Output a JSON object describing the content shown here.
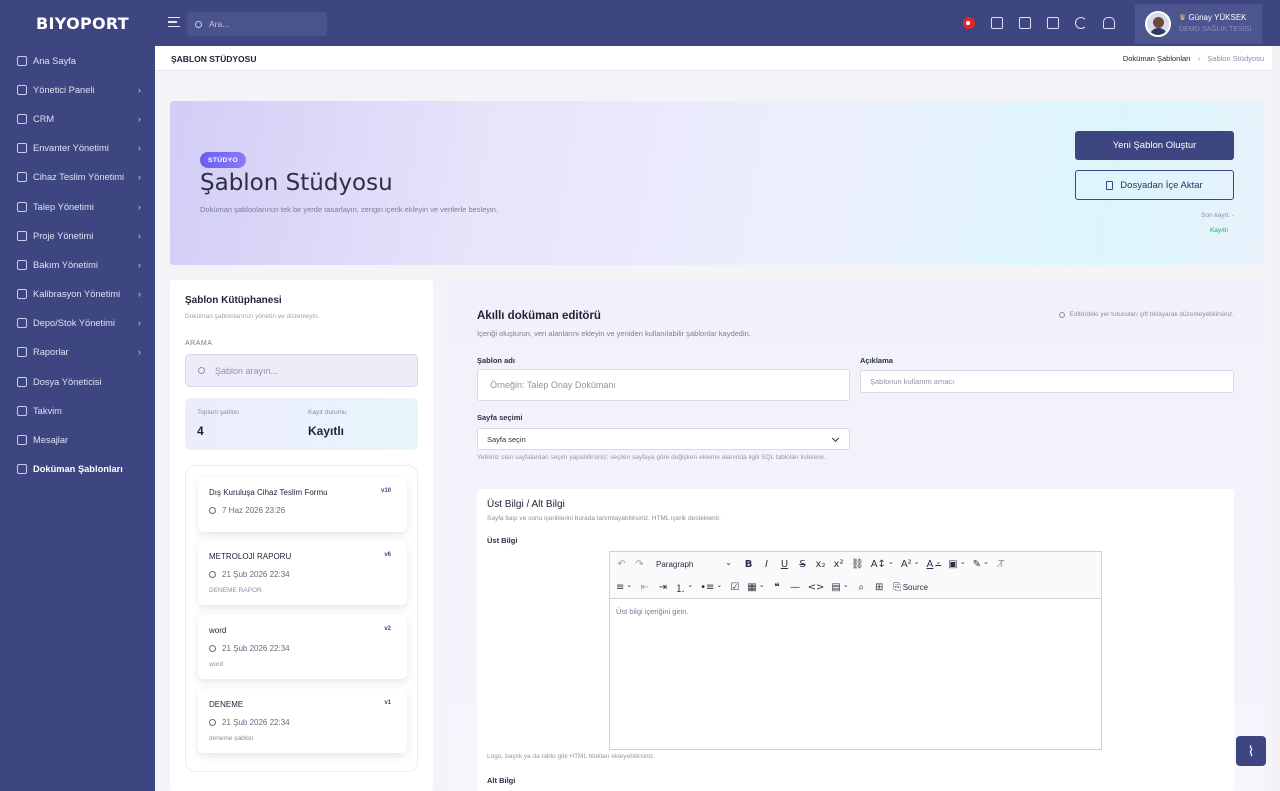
{
  "brand": "BIYOPORT",
  "sidebar": {
    "items": [
      {
        "label": "Ana Sayfa",
        "chev": ""
      },
      {
        "label": "Yönetici Paneli",
        "chev": "›"
      },
      {
        "label": "CRM",
        "chev": "›"
      },
      {
        "label": "Envanter Yönetimi",
        "chev": "›"
      },
      {
        "label": "Cihaz Teslim Yönetimi",
        "chev": "›"
      },
      {
        "label": "Talep Yönetimi",
        "chev": "›"
      },
      {
        "label": "Proje Yönetimi",
        "chev": "›"
      },
      {
        "label": "Bakım Yönetimi",
        "chev": "›"
      },
      {
        "label": "Kalibrasyon Yönetimi",
        "chev": "›"
      },
      {
        "label": "Depo/Stok Yönetimi",
        "chev": "›"
      },
      {
        "label": "Raporlar",
        "chev": "›"
      },
      {
        "label": "Dosya Yöneticisi",
        "chev": ""
      },
      {
        "label": "Takvim",
        "chev": ""
      },
      {
        "label": "Mesajlar",
        "chev": ""
      },
      {
        "label": "Doküman Şablonları",
        "chev": ""
      }
    ]
  },
  "topbar": {
    "search_placeholder": "Ara...",
    "user_name": "Günay YÜKSEK",
    "user_crown": "♛",
    "user_org": "DEMO SAĞLIK TESİSİ"
  },
  "breadcrumb": {
    "page_title": "ŞABLON STÜDYOSU",
    "parent": "Doküman Şablonları",
    "separator": "›",
    "current": "Şablon Stüdyosu"
  },
  "hero": {
    "badge": "STÜDYO",
    "title": "Şablon Stüdyosu",
    "description": "Doküman şablonlarınızı tek bir yerde tasarlayın, zengin içerik ekleyin ve verilerle besleyin.",
    "new_button": "Yeni Şablon Oluştur",
    "import_button": "Dosyadan İçe Aktar",
    "last_save_label": "Son kayıt: -",
    "save_status": "Kayıtlı"
  },
  "library": {
    "title": "Şablon Kütüphanesi",
    "subtitle": "Doküman şablonlarınızı yönetin ve düzenleyin.",
    "search_label": "ARAMA",
    "search_placeholder": "Şablon arayın...",
    "total_label": "Toplam şablon",
    "total_value": "4",
    "status_label": "Kayıt durumu",
    "status_value": "Kayıtlı",
    "templates": [
      {
        "name": "Dış Kuruluşa Cihaz Teslim Formu",
        "version": "v10",
        "date": "7 Haz 2026 23:26",
        "desc": ""
      },
      {
        "name": "METROLOJİ RAPORU",
        "version": "v6",
        "date": "21 Şub 2026 22:34",
        "desc": "DENEME RAPOR"
      },
      {
        "name": "word",
        "version": "v2",
        "date": "21 Şub 2026 22:34",
        "desc": "word"
      },
      {
        "name": "DENEME",
        "version": "v1",
        "date": "21 Şub 2026 22:34",
        "desc": "deneme şablon"
      }
    ]
  },
  "editor": {
    "title": "Akıllı doküman editörü",
    "subtitle": "İçeriği oluşturun, veri alanlarını ekleyin ve yeniden kullanılabilir şablonlar kaydedin.",
    "hint": "Editördeki yer tutucuları çift tıklayarak düzenleyebilirsiniz.",
    "name_label": "Şablon adı",
    "name_placeholder": "Örneğin: Talep Onay Dokümanı",
    "desc_label": "Açıklama",
    "desc_placeholder": "Şablonun kullanım amacı",
    "page_label": "Sayfa seçimi",
    "page_value": "Sayfa seçin",
    "page_help": "Yetkiniz olan sayfalardan seçim yapabilirsiniz; seçilen sayfaya göre değişken ekleme alanında ilgili SQL tabloları listelenir."
  },
  "header_footer": {
    "title": "Üst Bilgi / Alt Bilgi",
    "subtitle": "Sayfa başı ve sonu içeriklerini burada tanımlayabilirsiniz. HTML içerik desteklenir.",
    "header_label": "Üst Bilgi",
    "rte_paragraph": "Paragraph",
    "rte_source": "Source",
    "header_placeholder": "Üst bilgi içeriğini girin.",
    "help": "Logo, başlık ya da tablo gibi HTML blokları ekleyebilirsiniz.",
    "footer_label": "Alt Bilgi"
  },
  "colors": {
    "sidebar": "#3d4680",
    "accent": "#6a5ef0",
    "success": "#29a86a"
  }
}
